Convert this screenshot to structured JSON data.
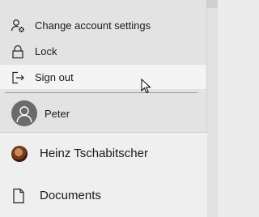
{
  "account_menu": {
    "items": [
      {
        "label": "Change account settings",
        "icon": "person-settings-icon"
      },
      {
        "label": "Lock",
        "icon": "lock-icon"
      },
      {
        "label": "Sign out",
        "icon": "sign-out-icon"
      }
    ],
    "other_account": {
      "name": "Peter",
      "icon": "person-avatar-icon"
    }
  },
  "start_list": {
    "user": {
      "name": "Heinz Tschabitscher"
    },
    "documents": {
      "label": "Documents",
      "icon": "document-icon"
    }
  },
  "colors": {
    "flyout_bg": "#e3e3e3",
    "hover_bg": "#f4f4f4",
    "avatar_bg": "#6b6b6b"
  }
}
